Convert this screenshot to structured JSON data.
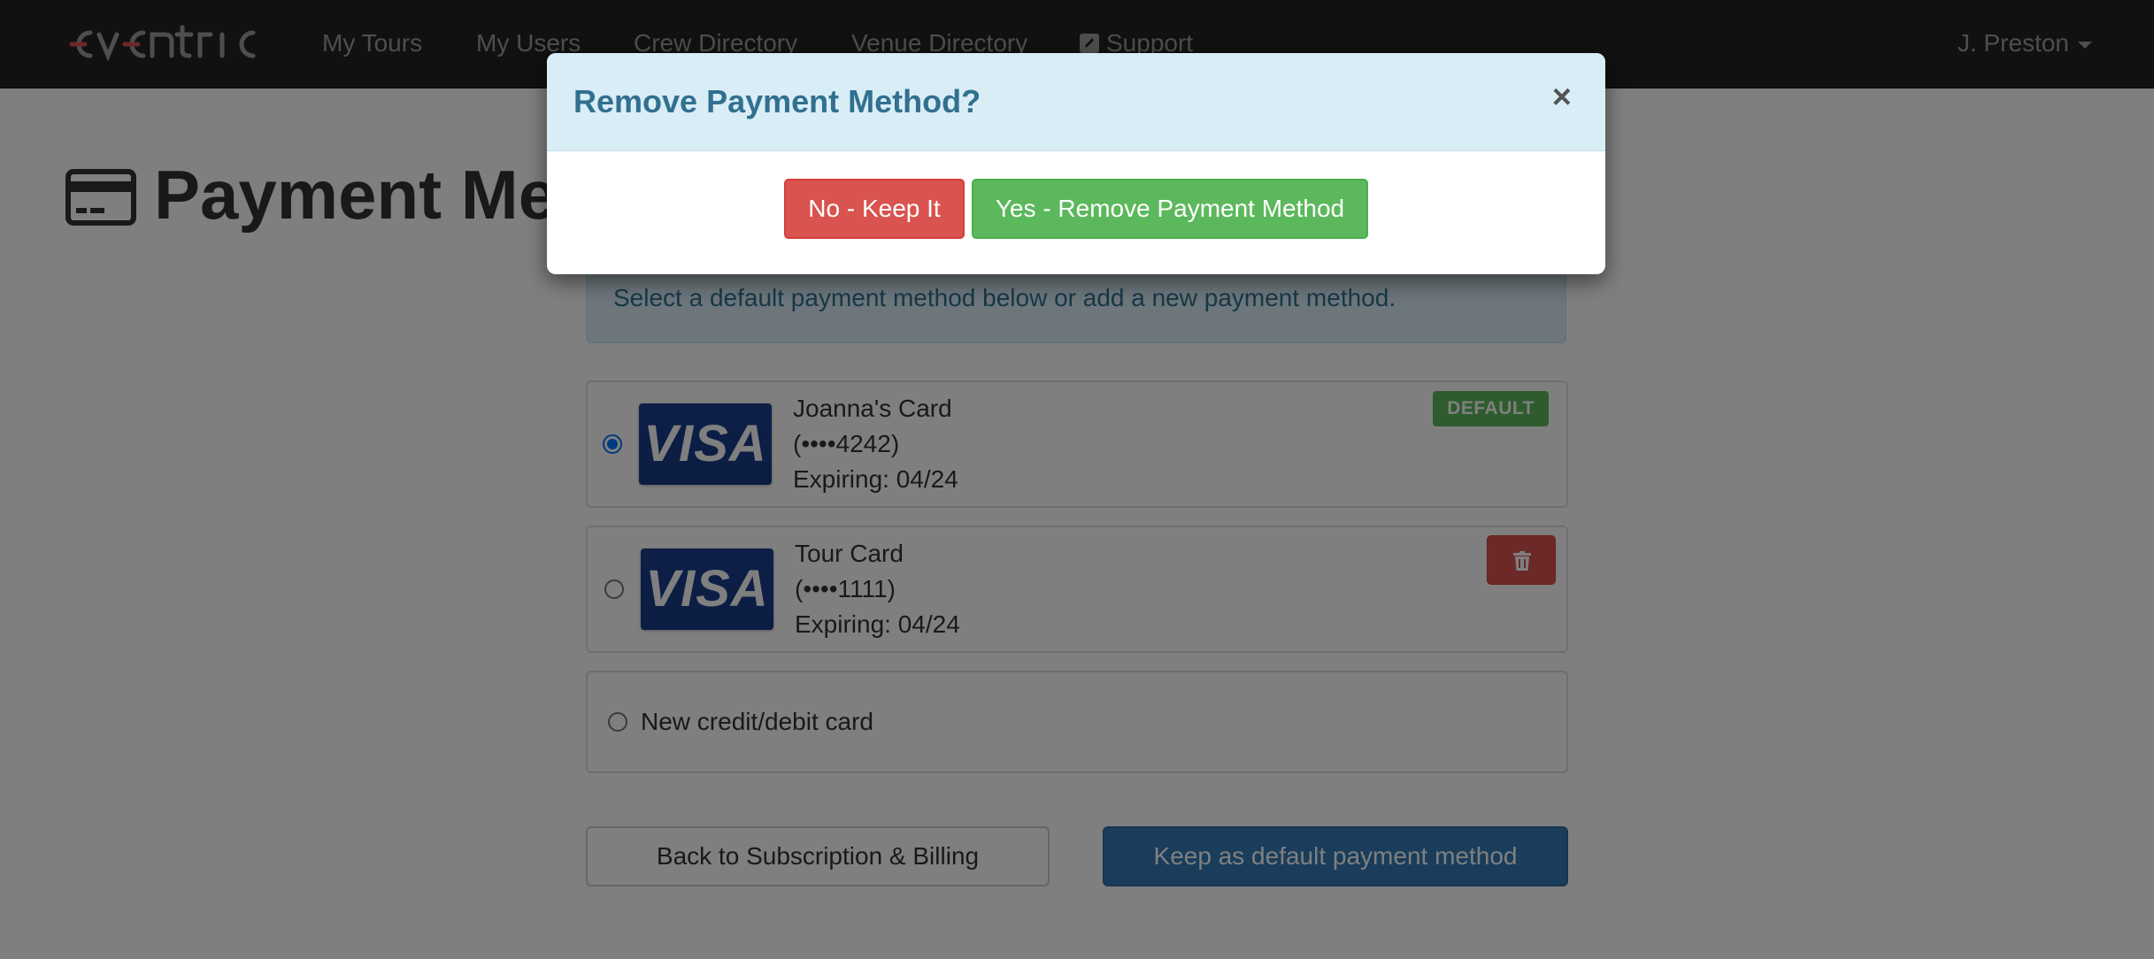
{
  "navbar": {
    "brand": "eventric",
    "items": [
      "My Tours",
      "My Users",
      "Crew Directory",
      "Venue Directory",
      "Support"
    ],
    "user": "J. Preston"
  },
  "page": {
    "title": "Payment Methods",
    "info": "Select a default payment method below or add a new payment method."
  },
  "payment_methods": [
    {
      "name": "Joanna's Card",
      "number": "(••••4242)",
      "expiry": "Expiring: 04/24",
      "brand": "VISA",
      "selected": true,
      "badge": "DEFAULT"
    },
    {
      "name": "Tour Card",
      "number": "(••••1111)",
      "expiry": "Expiring: 04/24",
      "brand": "VISA",
      "selected": false
    }
  ],
  "new_card_label": "New credit/debit card",
  "buttons": {
    "back": "Back to Subscription & Billing",
    "keep_default": "Keep as default payment method"
  },
  "modal": {
    "title": "Remove Payment Method?",
    "close": "×",
    "no_label": "No - Keep It",
    "yes_label": "Yes - Remove Payment Method"
  },
  "colors": {
    "navbar": "#222222",
    "info_bg": "#d9edf7",
    "danger": "#d9534f",
    "success": "#5cb85c",
    "primary": "#337ab7"
  }
}
